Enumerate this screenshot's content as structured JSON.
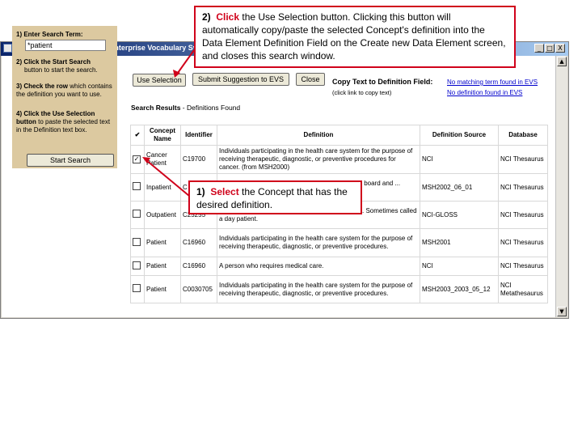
{
  "window": {
    "title": "CDE Curation Tool: Search Enterprise Vocabulary System",
    "controls": [
      "_",
      "□",
      "X"
    ]
  },
  "left_panel": {
    "step1": "1) Enter Search Term:",
    "search_value": "*patient",
    "step2_bold": "2) Click the Start Search",
    "step2_rest": "button to start the search.",
    "step3_bold": "3) Check the row",
    "step3_rest": "which contains the definition you want to use.",
    "step4_bold": "4) Click the Use Selection button",
    "step4_rest": "to paste the selected text in the Definition text box.",
    "start_button": "Start Search"
  },
  "toolbar": {
    "use_selection": "Use Selection",
    "submit_suggestion": "Submit Suggestion to EVS",
    "close": "Close",
    "copy_label": "Copy Text to Definition Field:",
    "copy_hint": "(click link to copy text)",
    "link_no_match": "No matching term found in EVS",
    "link_no_definition": "No definition found in EVS"
  },
  "results": {
    "label_bold": "Search Results",
    "label_rest": " - Definitions Found",
    "headers": [
      "✔",
      "Concept Name",
      "Identifier",
      "Definition",
      "Definition Source",
      "Database"
    ],
    "rows": [
      {
        "checked": true,
        "concept": "Cancer Patient",
        "id": "C19700",
        "definition": "Individuals participating in the health care system for the purpose of receiving therapeutic, diagnostic, or preventive procedures for cancer. (from MSH2000)",
        "source": "NCI",
        "database": "NCI Thesaurus"
      },
      {
        "checked": false,
        "concept": "Inpatient",
        "id": "C",
        "definition": "Persons admitted to health facilities which provide board and ... agnosis or",
        "source": "MSH2002_06_01",
        "database": "NCI Thesaurus"
      },
      {
        "checked": false,
        "concept": "Outpatient",
        "id": "C25255",
        "definition": "... agnosis or treatment without spending the night. Sometimes called a day patient.",
        "source": "NCI-GLOSS",
        "database": "NCI Thesaurus"
      },
      {
        "checked": false,
        "concept": "Patient",
        "id": "C16960",
        "definition": "Individuals participating in the health care system for the purpose of receiving therapeutic, diagnostic, or preventive procedures.",
        "source": "MSH2001",
        "database": "NCI Thesaurus"
      },
      {
        "checked": false,
        "concept": "Patient",
        "id": "C16960",
        "definition": "A person who requires medical care.",
        "source": "NCI",
        "database": "NCI Thesaurus"
      },
      {
        "checked": false,
        "concept": "Patient",
        "id": "C0030705",
        "definition": "Individuals participating in the health care system for the purpose of receiving therapeutic, diagnostic, or preventive procedures.",
        "source": "MSH2003_2003_05_12",
        "database": "NCI Metathesaurus"
      }
    ]
  },
  "callout_top": {
    "num": "2)",
    "keyword": "Click",
    "text": " the Use Selection button. Clicking this button will automatically copy/paste the selected Concept's definition into the Data Element Definition Field on the Create new Data Element screen, and closes this search window."
  },
  "callout_mid": {
    "num": "1)",
    "keyword": "Select",
    "text": " the Concept that has the desired definition."
  },
  "colors": {
    "accent_red": "#d0021b",
    "panel_tan": "#dcc9a0",
    "link_blue": "#0000cc",
    "titlebar": "#0a246a"
  }
}
